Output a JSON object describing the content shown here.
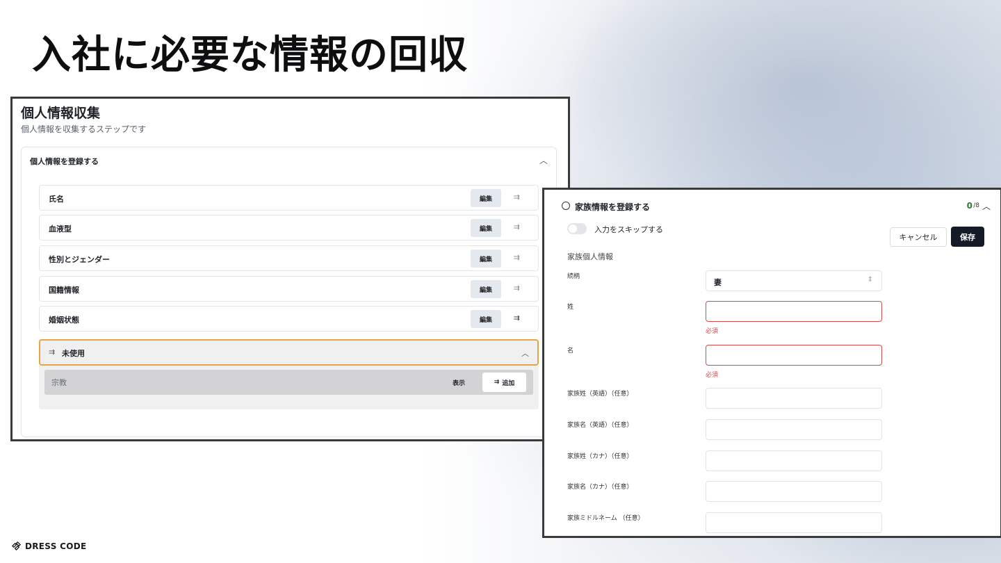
{
  "slide": {
    "title": "入社に必要な情報の回収"
  },
  "left_panel": {
    "title": "個人情報収集",
    "subtitle": "個人情報を収集するステップです",
    "card_title": "個人情報を登録する",
    "rows": [
      {
        "label": "氏名",
        "edit_label": "編集"
      },
      {
        "label": "血液型",
        "edit_label": "編集"
      },
      {
        "label": "性別とジェンダー",
        "edit_label": "編集"
      },
      {
        "label": "国籍情報",
        "edit_label": "編集"
      },
      {
        "label": "婚姻状態",
        "edit_label": "編集"
      }
    ],
    "unused": {
      "label": "未使用",
      "item_label": "宗教",
      "show_label": "表示",
      "add_label": "追加"
    }
  },
  "right_panel": {
    "title": "家族情報を登録する",
    "count": "0",
    "count_total": "/8",
    "skip_label": "入力をスキップする",
    "cancel_label": "キャンセル",
    "save_label": "保存",
    "section_label": "家族個人情報",
    "fields": [
      {
        "label": "続柄",
        "value": "妻"
      },
      {
        "label": "姓",
        "error": "必須"
      },
      {
        "label": "名",
        "error": "必須"
      },
      {
        "label": "家族姓（英語）（任意）"
      },
      {
        "label": "家族名（英語）（任意）"
      },
      {
        "label": "家族姓（カナ）（任意）"
      },
      {
        "label": "家族名（カナ）（任意）"
      },
      {
        "label": "家族ミドルネーム （任意）"
      }
    ]
  },
  "logo": {
    "text": "DRESS CODE"
  },
  "colors": {
    "accent_orange": "#e6a545",
    "error_red": "#cf4b4b",
    "count_green": "#2e7d32",
    "save_dark": "#141a26"
  },
  "icons": [
    "chevron-up-icon",
    "list-arrow-icon",
    "select-updown-icon",
    "circle-outline-icon",
    "dress-code-logo-icon"
  ]
}
